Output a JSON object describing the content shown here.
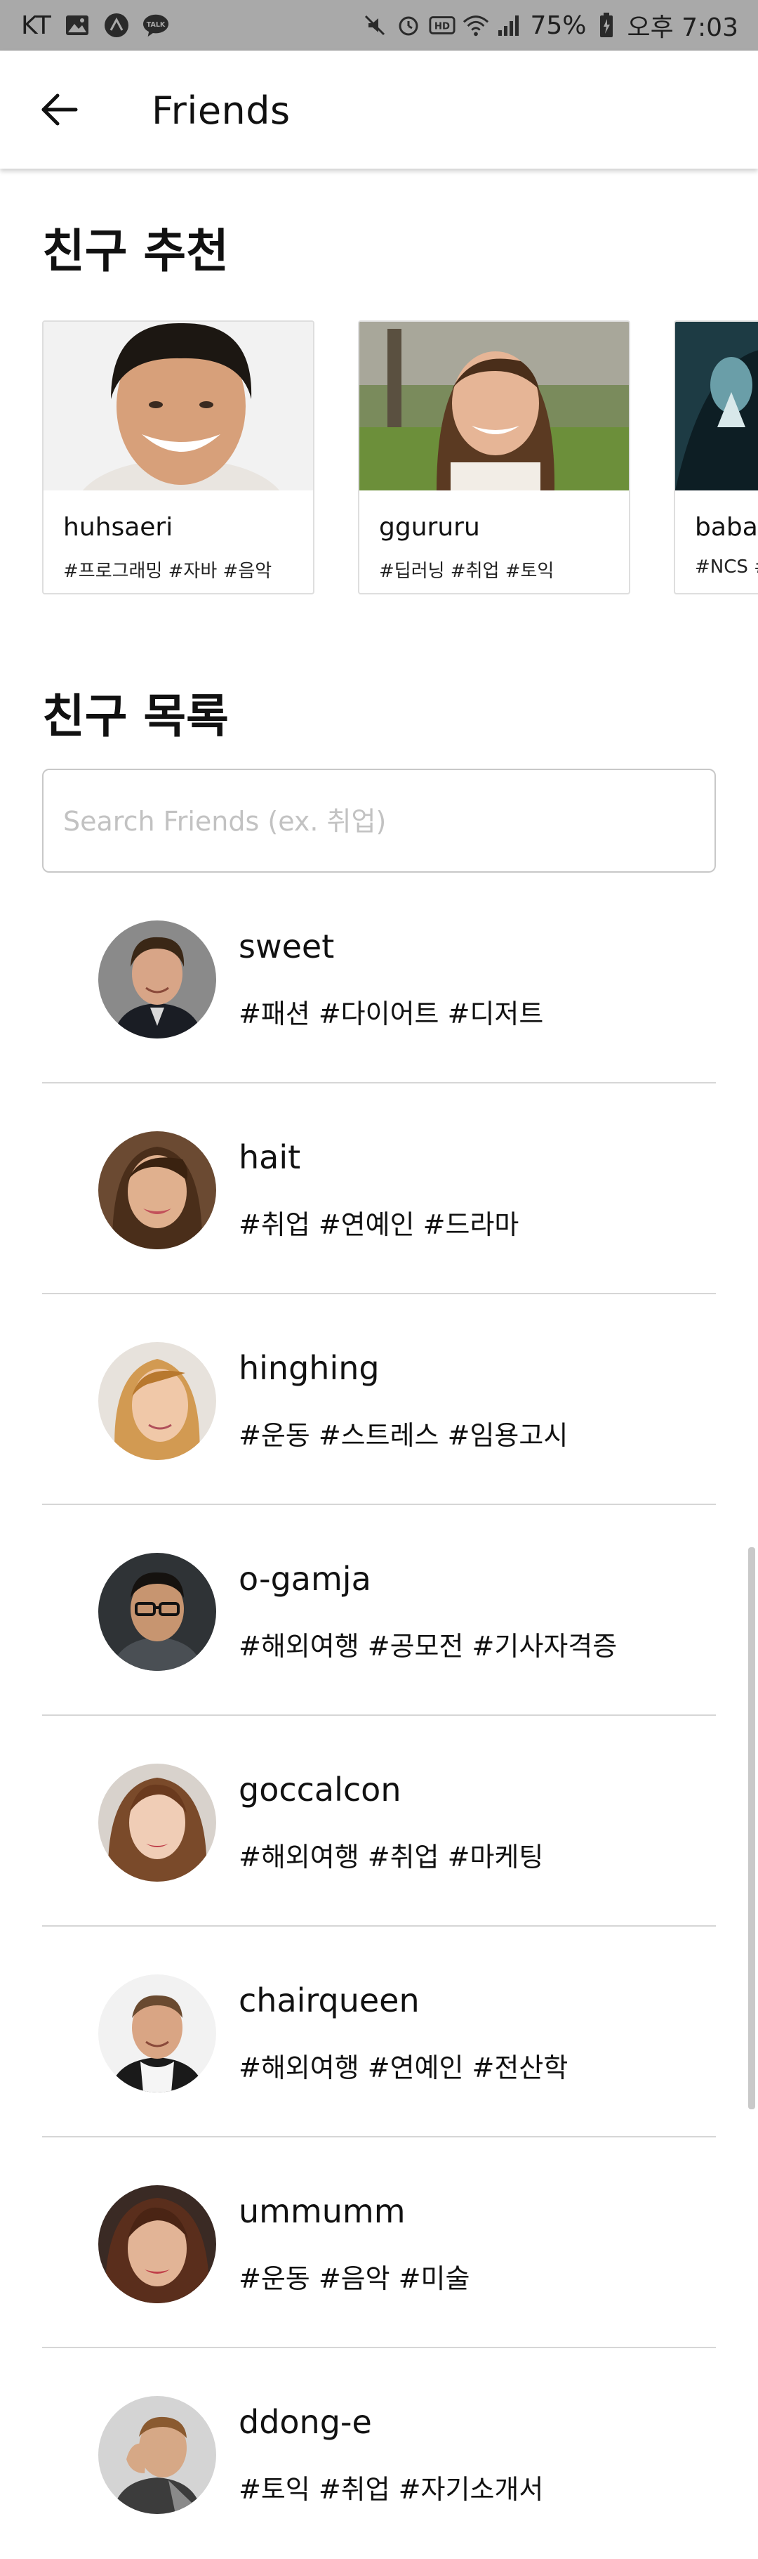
{
  "status_bar": {
    "carrier": "KT",
    "battery": "75%",
    "time": "오후 7:03"
  },
  "app_bar": {
    "title": "Friends"
  },
  "recommendations": {
    "heading": "친구 추천",
    "cards": [
      {
        "name": "huhsaeri",
        "tags": "#프로그래밍 #자바 #음악"
      },
      {
        "name": "ggururu",
        "tags": "#딥러닝 #취업 #토익"
      },
      {
        "name": "baba",
        "tags": "#NCS #"
      }
    ]
  },
  "friends": {
    "heading": "친구 목록",
    "search_placeholder": "Search Friends (ex. 취업)",
    "items": [
      {
        "name": "sweet",
        "tags": "#패션 #다이어트 #디저트"
      },
      {
        "name": "hait",
        "tags": "#취업 #연예인 #드라마"
      },
      {
        "name": "hinghing",
        "tags": "#운동 #스트레스 #임용고시"
      },
      {
        "name": "o-gamja",
        "tags": "#해외여행 #공모전 #기사자격증"
      },
      {
        "name": "goccalcon",
        "tags": "#해외여행 #취업 #마케팅"
      },
      {
        "name": "chairqueen",
        "tags": "#해외여행 #연예인 #전산학"
      },
      {
        "name": "ummumm",
        "tags": "#운동 #음악 #미술"
      },
      {
        "name": "ddong-e",
        "tags": "#토익 #취업 #자기소개서"
      }
    ]
  }
}
